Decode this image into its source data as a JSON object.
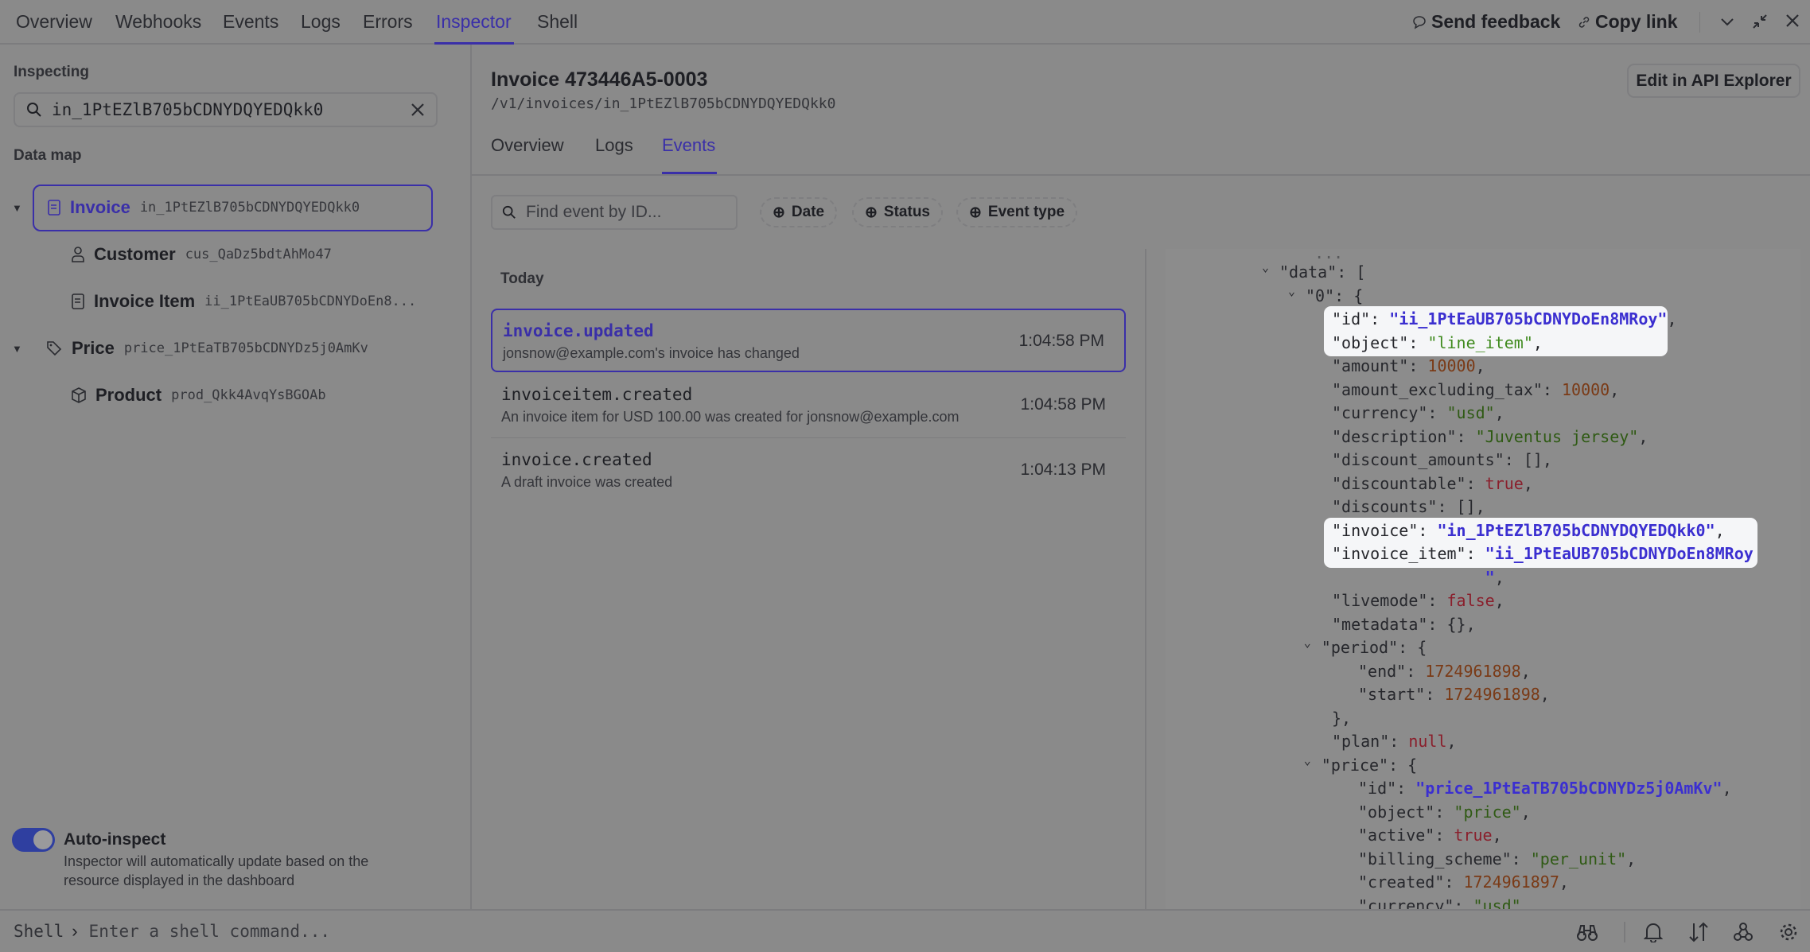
{
  "nav": {
    "tabs": [
      "Overview",
      "Webhooks",
      "Events",
      "Logs",
      "Errors",
      "Inspector",
      "Shell"
    ],
    "active": "Inspector",
    "send_feedback": "Send feedback",
    "copy_link": "Copy link"
  },
  "left": {
    "inspecting_label": "Inspecting",
    "search_value": "in_1PtEZlB705bCDNYDQYEDQkk0",
    "data_map_label": "Data map",
    "tree": [
      {
        "type": "Invoice",
        "id": "in_1PtEZlB705bCDNYDQYEDQkk0",
        "icon": "document-icon"
      },
      {
        "type": "Customer",
        "id": "cus_QaDz5bdtAhMo47",
        "icon": "person-icon"
      },
      {
        "type": "Invoice Item",
        "id": "ii_1PtEaUB705bCDNYDoEn8...",
        "icon": "document-icon"
      },
      {
        "type": "Price",
        "id": "price_1PtEaTB705bCDNYDz5j0AmKv",
        "icon": "tag-icon"
      },
      {
        "type": "Product",
        "id": "prod_Qkk4AvqYsBGOAb",
        "icon": "box-icon"
      }
    ],
    "auto_inspect": {
      "label": "Auto-inspect",
      "description_1": "Inspector will automatically update based on the",
      "description_2": "resource displayed in the dashboard",
      "enabled": true
    }
  },
  "main": {
    "title": "Invoice 473446A5-0003",
    "path": "/v1/invoices/in_1PtEZlB705bCDNYDQYEDQkk0",
    "edit_button": "Edit in API Explorer",
    "tabs": [
      "Overview",
      "Logs",
      "Events"
    ],
    "active_tab": "Events",
    "find_placeholder": "Find event by ID...",
    "filters": [
      "Date",
      "Status",
      "Event type"
    ],
    "group_label": "Today",
    "events": [
      {
        "name": "invoice.updated",
        "desc": "jonsnow@example.com's invoice has changed",
        "time": "1:04:58 PM"
      },
      {
        "name": "invoiceitem.created",
        "desc": "An invoice item for USD 100.00 was created for jonsnow@example.com",
        "time": "1:04:58 PM"
      },
      {
        "name": "invoice.created",
        "desc": "A draft invoice was created",
        "time": "1:04:13 PM"
      }
    ]
  },
  "json_lines": [
    {
      "i": 0,
      "c": true,
      "k": "data",
      "p": "["
    },
    {
      "i": 1,
      "c": true,
      "k": "0",
      "p": "{"
    },
    {
      "i": 2,
      "k": "id",
      "v": "\"ii_1PtEaUB705bCDNYDoEn8MRoy\"",
      "t": "link",
      "s": ",",
      "h": 1
    },
    {
      "i": 2,
      "k": "object",
      "v": "\"line_item\"",
      "t": "strG",
      "s": ",",
      "h": 1
    },
    {
      "i": 2,
      "k": "amount",
      "v": "10000",
      "t": "num",
      "s": ","
    },
    {
      "i": 2,
      "k": "amount_excluding_tax",
      "v": "10000",
      "t": "num",
      "s": ","
    },
    {
      "i": 2,
      "k": "currency",
      "v": "\"usd\"",
      "t": "strG",
      "s": ","
    },
    {
      "i": 2,
      "k": "description",
      "v": "\"Juventus jersey\"",
      "t": "strG",
      "s": ","
    },
    {
      "i": 2,
      "k": "discount_amounts",
      "v": "[]",
      "t": "",
      "s": ","
    },
    {
      "i": 2,
      "k": "discountable",
      "v": "true",
      "t": "kw",
      "s": ","
    },
    {
      "i": 2,
      "k": "discounts",
      "v": "[]",
      "t": "",
      "s": ","
    },
    {
      "i": 2,
      "k": "invoice",
      "v": "\"in_1PtEZlB705bCDNYDQYEDQkk0\"",
      "t": "link",
      "s": ",",
      "h": 2
    },
    {
      "i": 2,
      "k": "invoice_item",
      "v": "\"ii_1PtEaUB705bCDNYDoEn8MRoy",
      "t": "link",
      "s": "",
      "h": 2
    },
    {
      "i": 2,
      "raw": "                \"",
      "t": "link",
      "s": ","
    },
    {
      "i": 2,
      "k": "livemode",
      "v": "false",
      "t": "kw",
      "s": ","
    },
    {
      "i": 2,
      "k": "metadata",
      "v": "{}",
      "t": "",
      "s": ","
    },
    {
      "i": 1.6,
      "c": true,
      "k": "period",
      "p": "{"
    },
    {
      "i": 3,
      "k": "end",
      "v": "1724961898",
      "t": "num",
      "s": ","
    },
    {
      "i": 3,
      "k": "start",
      "v": "1724961898",
      "t": "num",
      "s": ","
    },
    {
      "i": 2,
      "raw": "},"
    },
    {
      "i": 2,
      "k": "plan",
      "v": "null",
      "t": "kw",
      "s": ","
    },
    {
      "i": 1.6,
      "c": true,
      "k": "price",
      "p": "{"
    },
    {
      "i": 3,
      "k": "id",
      "v": "\"price_1PtEaTB705bCDNYDz5j0AmKv\"",
      "t": "link",
      "s": ","
    },
    {
      "i": 3,
      "k": "object",
      "v": "\"price\"",
      "t": "strG",
      "s": ","
    },
    {
      "i": 3,
      "k": "active",
      "v": "true",
      "t": "kw",
      "s": ","
    },
    {
      "i": 3,
      "k": "billing_scheme",
      "v": "\"per_unit\"",
      "t": "strG",
      "s": ","
    },
    {
      "i": 3,
      "k": "created",
      "v": "1724961897",
      "t": "num",
      "s": ","
    },
    {
      "i": 3,
      "k": "currency",
      "v": "\"usd\"",
      "t": "strG",
      "s": ","
    }
  ],
  "shell": {
    "prompt": "Shell",
    "placeholder": "Enter a shell command..."
  },
  "colors": {
    "accent": "#3a2fa8",
    "link": "#3b2fd0",
    "overlay": "#8a8a8a"
  }
}
